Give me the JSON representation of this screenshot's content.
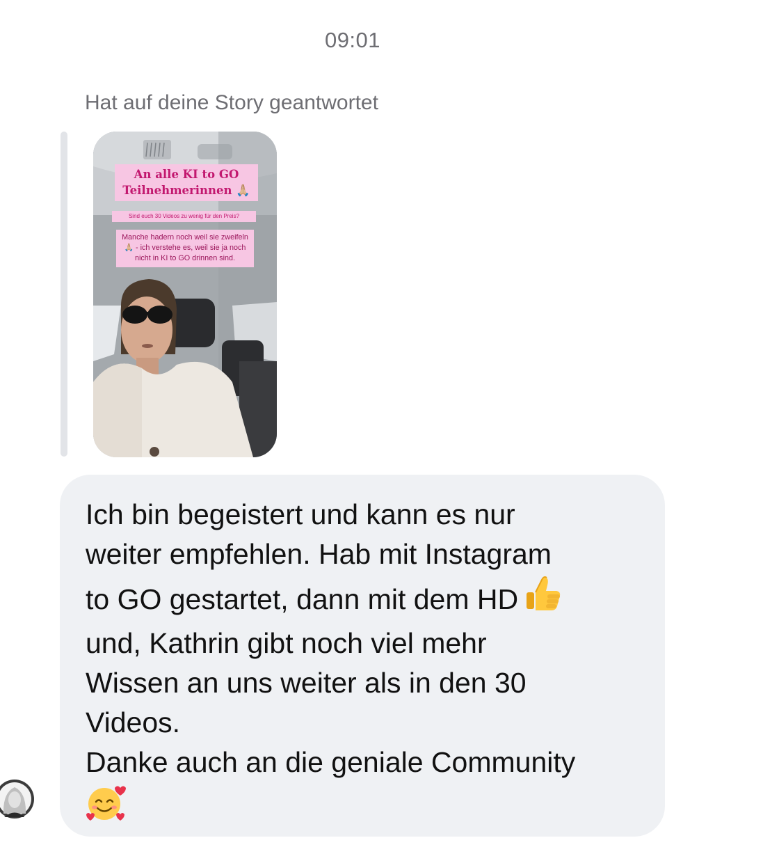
{
  "header": {
    "time": "09:01"
  },
  "reply": {
    "label": "Hat auf deine Story geantwortet"
  },
  "story": {
    "title_line1": "An alle KI to GO",
    "title_line2": "Teilnehmerinnen 🙏🏼",
    "subtitle": "Sind euch 30 Videos zu wenig für den Preis?",
    "body": "Manche hadern noch weil sie zweifeln 🙏🏼 - ich verstehe es, weil sie ja noch nicht in KI to GO drinnen sind."
  },
  "message": {
    "text": "Ich bin begeistert und kann es nur\nweiter empfehlen.  Hab mit Instagram\nto GO gestartet, dann mit dem HD",
    "text_after": "und, Kathrin gibt noch viel mehr\nWissen an uns weiter als in den 30\nVideos.\nDanke auch an die geniale Community",
    "emoji_1": "thumbs-up-icon",
    "emoji_2": "smiling-face-with-hearts-icon"
  },
  "colors": {
    "bubble_bg": "#eff1f4",
    "story_pink": "#f7c6e3",
    "story_text": "#c2186f",
    "meta_text": "#6e6e73"
  }
}
